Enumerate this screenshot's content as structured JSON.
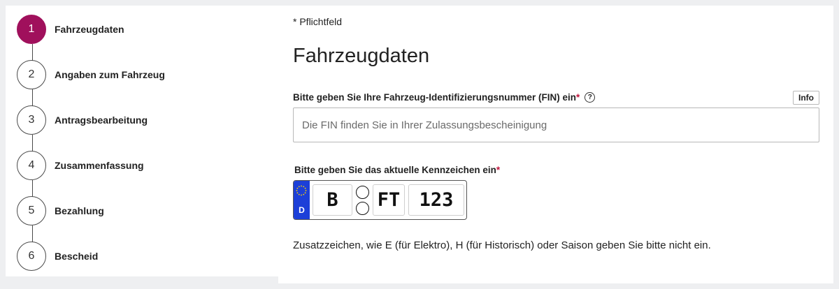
{
  "stepper": {
    "steps": [
      {
        "number": "1",
        "label": "Fahrzeugdaten"
      },
      {
        "number": "2",
        "label": "Angaben zum Fahrzeug"
      },
      {
        "number": "3",
        "label": "Antragsbearbeitung"
      },
      {
        "number": "4",
        "label": "Zusammenfassung"
      },
      {
        "number": "5",
        "label": "Bezahlung"
      },
      {
        "number": "6",
        "label": "Bescheid"
      }
    ],
    "active_step": 1
  },
  "form": {
    "required_note": "* Pflichtfeld",
    "title": "Fahrzeugdaten",
    "fin": {
      "label": "Bitte geben Sie Ihre Fahrzeug-Identifizierungsnummer (FIN) ein",
      "required_marker": "*",
      "help_icon_glyph": "?",
      "info_button": "Info",
      "placeholder": "Die FIN finden Sie in Ihrer Zulassungsbescheinigung",
      "value": ""
    },
    "plate": {
      "label": "Bitte geben Sie das aktuelle Kennzeichen ein",
      "required_marker": "*",
      "country_code": "D",
      "district": "B",
      "letters": "FT",
      "numbers": "123"
    },
    "hint": "Zusatzzeichen, wie E (für Elektro), H (für Historisch) oder Saison geben Sie bitte nicht ein."
  },
  "colors": {
    "active_step": "#a0105c",
    "eu_blue": "#1c3fd8",
    "required_star": "#c0143c"
  }
}
